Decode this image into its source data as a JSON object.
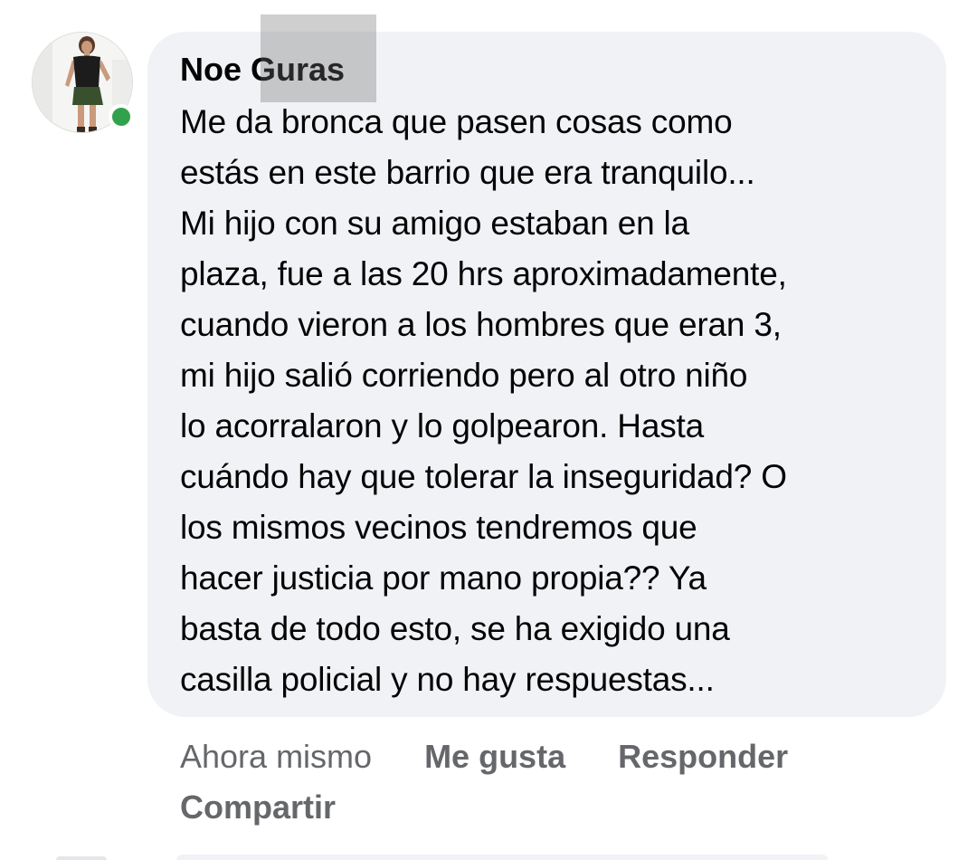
{
  "comment": {
    "author": "Noe Guras",
    "avatar_icon": "user-photo-avatar",
    "presence_color": "#31a24c",
    "lines": [
      "Me da bronca que pasen cosas como",
      "estás en este barrio que era tranquilo...",
      "Mi hijo con su amigo estaban en la",
      "plaza, fue a las 20 hrs aproximadamente,",
      "cuando vieron a los hombres que eran 3,",
      "mi hijo salió corriendo pero al otro niño",
      "lo acorralaron y lo golpearon. Hasta",
      "cuándo hay que tolerar la inseguridad? O",
      "los mismos vecinos tendremos que",
      "hacer justicia por mano propia?? Ya",
      "basta de todo esto, se ha exigido una",
      "casilla policial y no hay respuestas..."
    ],
    "timestamp": "Ahora mismo",
    "actions": {
      "like": "Me gusta",
      "reply": "Responder",
      "share": "Compartir"
    }
  },
  "colors": {
    "bubble_bg": "#f0f2f5",
    "text": "#050505",
    "secondary_text": "#65676b"
  }
}
